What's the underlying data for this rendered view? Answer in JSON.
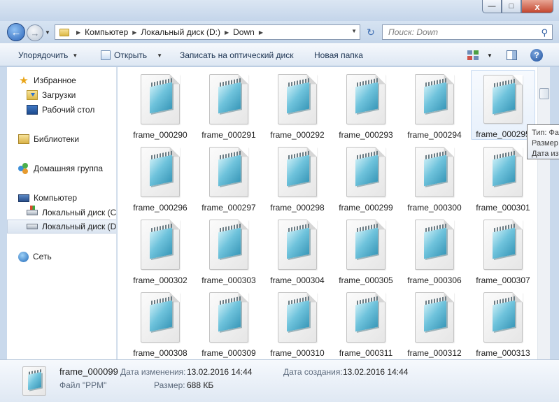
{
  "window": {
    "minimize": "—",
    "maximize": "□",
    "close": "x"
  },
  "nav": {
    "back": "←",
    "forward": "→",
    "crumbs": [
      "Компьютер",
      "Локальный диск (D:)",
      "Down"
    ],
    "refresh": "↻",
    "search_placeholder": "Поиск: Down"
  },
  "toolbar": {
    "organize": "Упорядочить",
    "open": "Открыть",
    "burn": "Записать на оптический диск",
    "new_folder": "Новая папка",
    "help": "?"
  },
  "navpane": {
    "favorites": "Избранное",
    "downloads": "Загрузки",
    "desktop": "Рабочий стол",
    "libraries": "Библиотеки",
    "homegroup": "Домашняя группа",
    "computer": "Компьютер",
    "drive_c": "Локальный диск (C",
    "drive_d": "Локальный диск (D",
    "network": "Сеть"
  },
  "files": [
    "frame_000290",
    "frame_000291",
    "frame_000292",
    "frame_000293",
    "frame_000294",
    "frame_000295",
    "frame_000296",
    "frame_000297",
    "frame_000298",
    "frame_000299",
    "frame_000300",
    "frame_000301",
    "frame_000302",
    "frame_000303",
    "frame_000304",
    "frame_000305",
    "frame_000306",
    "frame_000307",
    "frame_000308",
    "frame_000309",
    "frame_000310",
    "frame_000311",
    "frame_000312",
    "frame_000313"
  ],
  "tooltip": {
    "line1": "Тип: Фа",
    "line2": "Размер",
    "line3": "Дата из"
  },
  "details": {
    "name": "frame_000099",
    "type": "Файл \"PPM\"",
    "modified_label": "Дата изменения:",
    "modified_value": "13.02.2016 14:44",
    "size_label": "Размер:",
    "size_value": "688 КБ",
    "created_label": "Дата создания:",
    "created_value": "13.02.2016 14:44"
  },
  "colors": {
    "accent": "#2a63b8",
    "pad": "#6fc3dc"
  }
}
